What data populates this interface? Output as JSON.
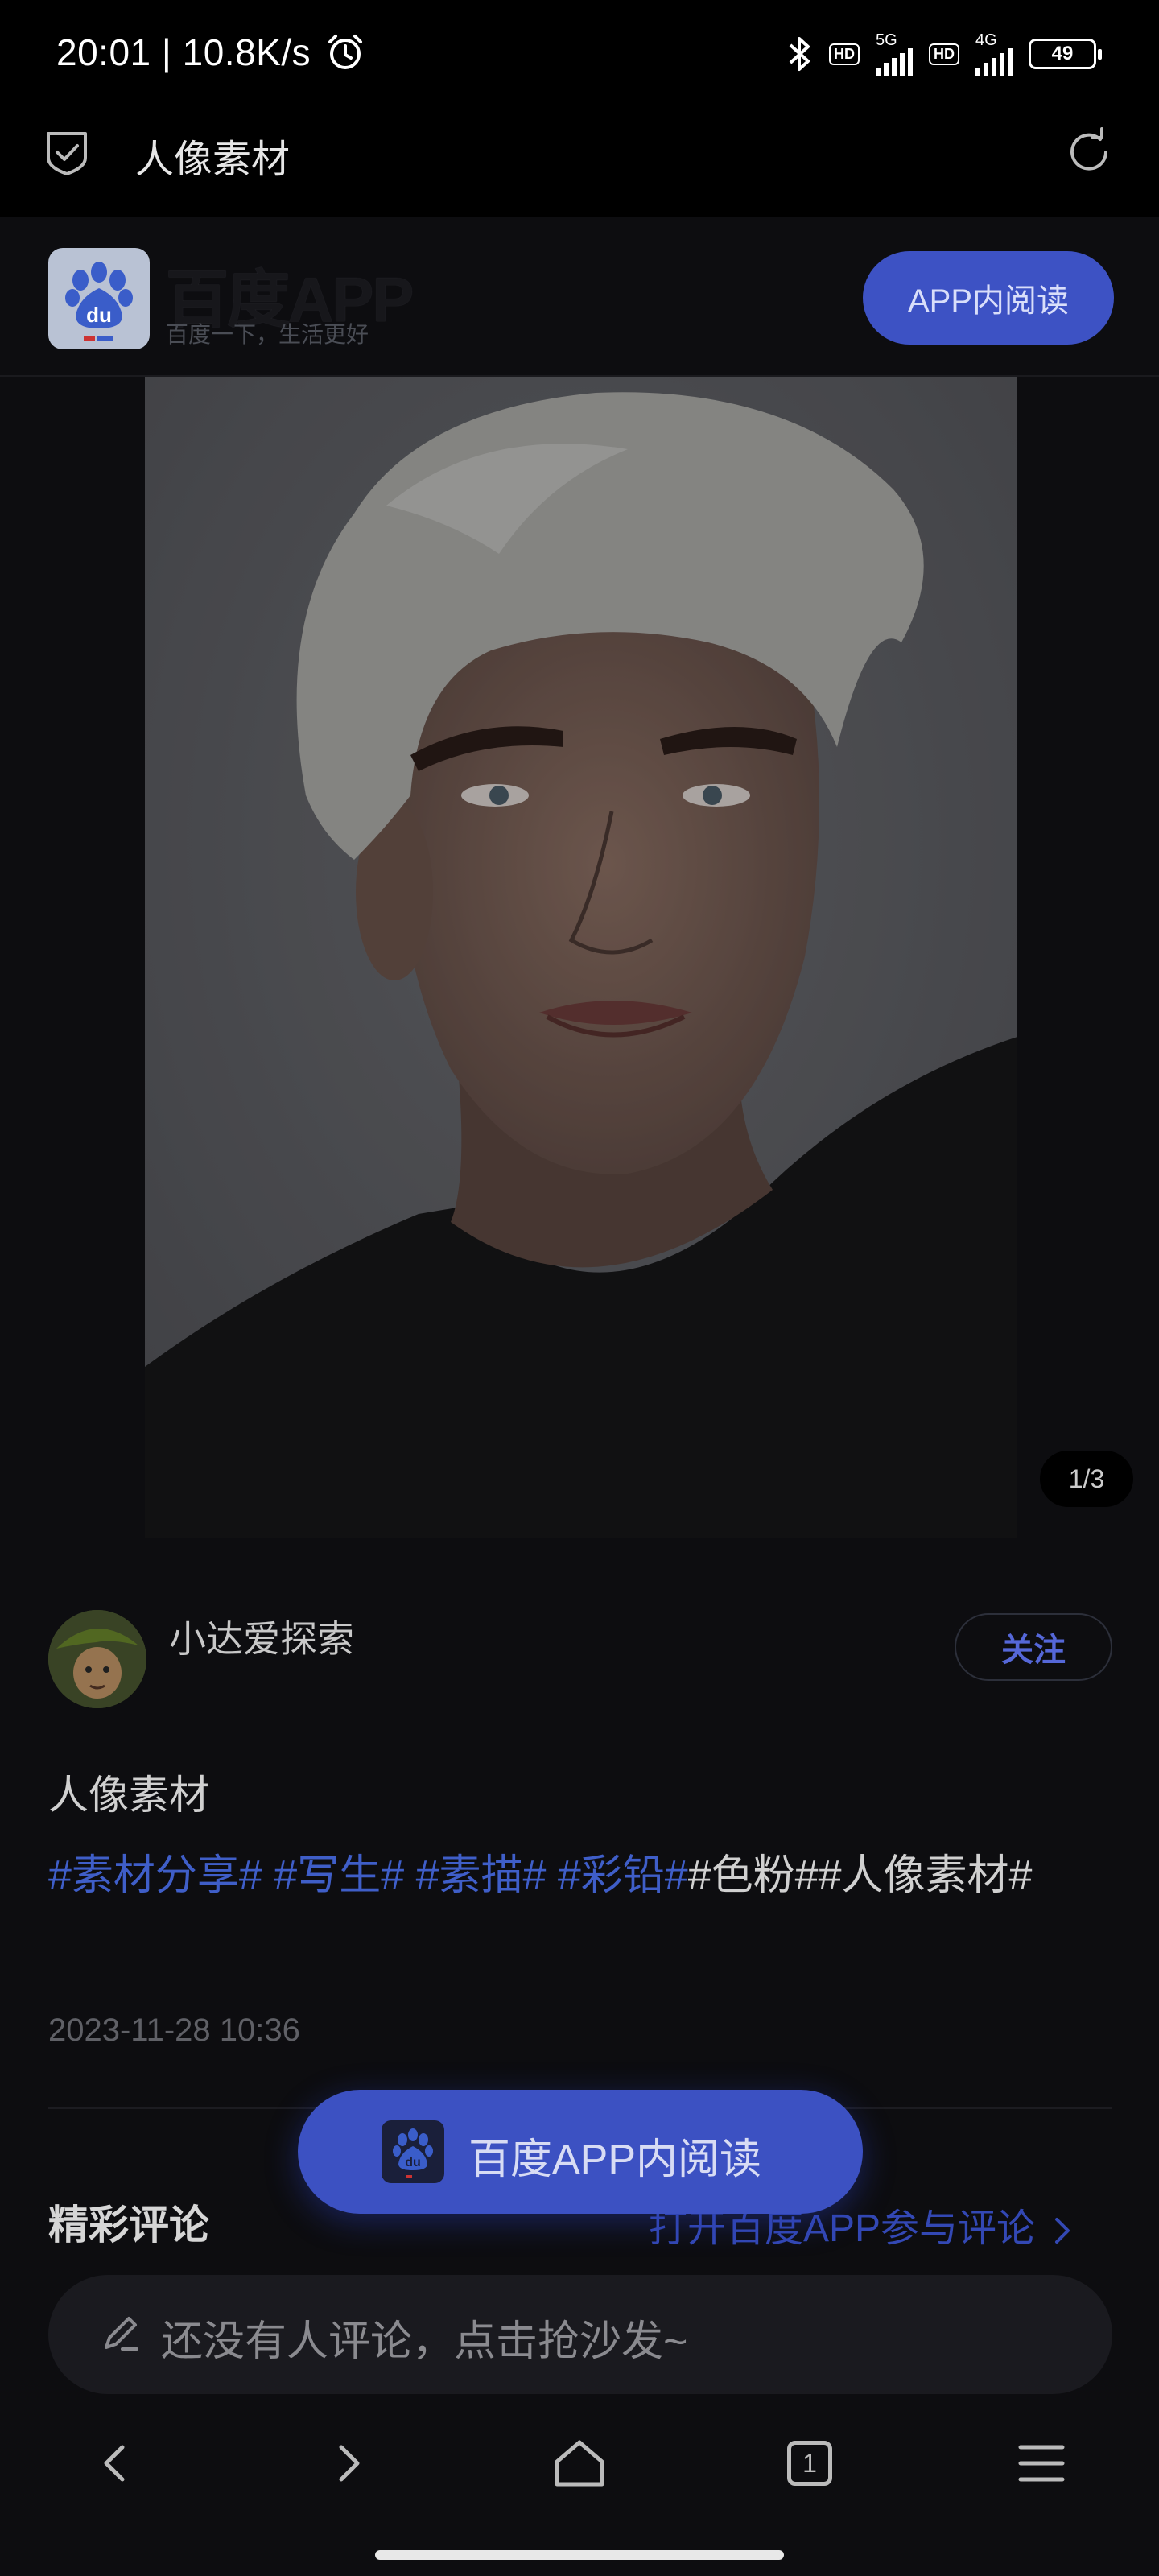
{
  "status_bar": {
    "time": "20:01 | 10.8K/s",
    "hd_label": "HD",
    "network_5g": "5G",
    "network_4g": "4G",
    "battery": "49"
  },
  "title_bar": {
    "title": "人像素材"
  },
  "header": {
    "brand_name": "百度APP",
    "slogan": "百度一下，生活更好",
    "read_in_app": "APP内阅读"
  },
  "gallery": {
    "page_indicator": "1/3",
    "total_images": 3,
    "active_index": 0
  },
  "post": {
    "author": "小达爱探索",
    "follow_label": "关注",
    "title": "人像素材",
    "tags_linked": [
      "#素材分享#",
      "#写生#",
      "#素描#",
      "#彩铅#"
    ],
    "tags_plain": "#色粉##人像素材#",
    "date": "2023-11-28 10:36"
  },
  "comments": {
    "section_title": "精彩评论",
    "open_app_link": "打开百度APP参与评论",
    "placeholder": "还没有人评论，点击抢沙发~"
  },
  "floating_button": {
    "label": "百度APP内阅读"
  },
  "bottom_nav": {
    "tab_count": "1"
  },
  "colors": {
    "accent": "#3d52c4",
    "link": "#3f5ec8",
    "background": "#0d0d10"
  },
  "icons": [
    "shield-check-icon",
    "refresh-icon",
    "baidu-paw-icon",
    "pencil-icon",
    "back-icon",
    "forward-icon",
    "home-icon",
    "tabs-icon",
    "menu-icon",
    "bluetooth-icon",
    "alarm-icon"
  ]
}
